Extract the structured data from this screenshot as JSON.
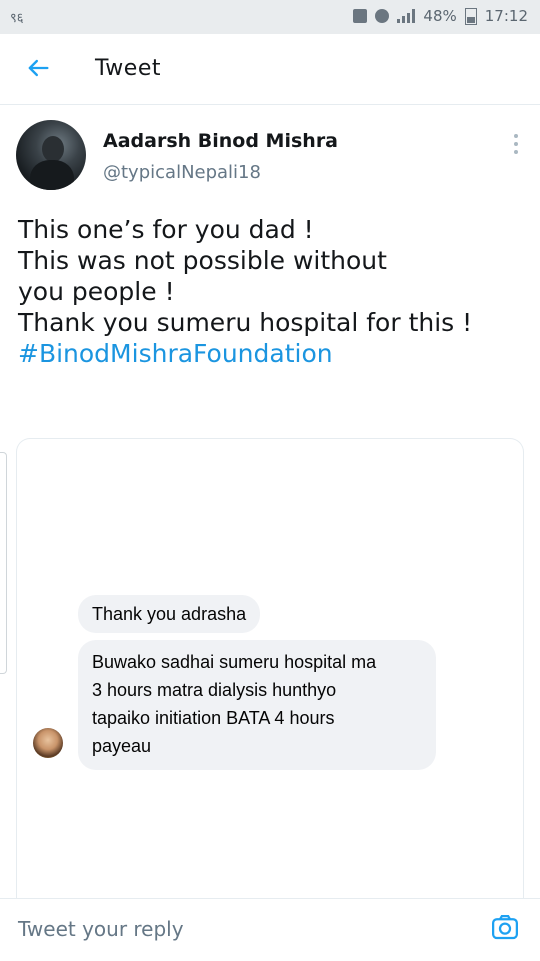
{
  "status_bar": {
    "left_text": "९६",
    "battery": "48%",
    "time": "17:12"
  },
  "header": {
    "title": "Tweet",
    "back_icon": "arrow-left-icon"
  },
  "tweet": {
    "author_name": "Aadarsh Binod Mishra",
    "handle": "@typicalNepali18",
    "lines": [
      "This one’s for you dad !",
      "This was not possible without",
      "you people !",
      "Thank you sumeru hospital for this !"
    ],
    "hashtag": "#BinodMishraFoundation"
  },
  "chat": {
    "message1": "Thank you adrasha",
    "message2_lines": [
      "Buwako sadhai sumeru hospital ma",
      "3 hours matra dialysis hunthyo",
      "tapaiko initiation  BATA  4 hours",
      "payeau"
    ]
  },
  "reply_bar": {
    "placeholder": "Tweet your reply",
    "camera_icon": "camera-icon"
  },
  "colors": {
    "accent": "#1da1f2",
    "hashtag": "#1b95e0",
    "bubble": "#f0f2f5"
  }
}
